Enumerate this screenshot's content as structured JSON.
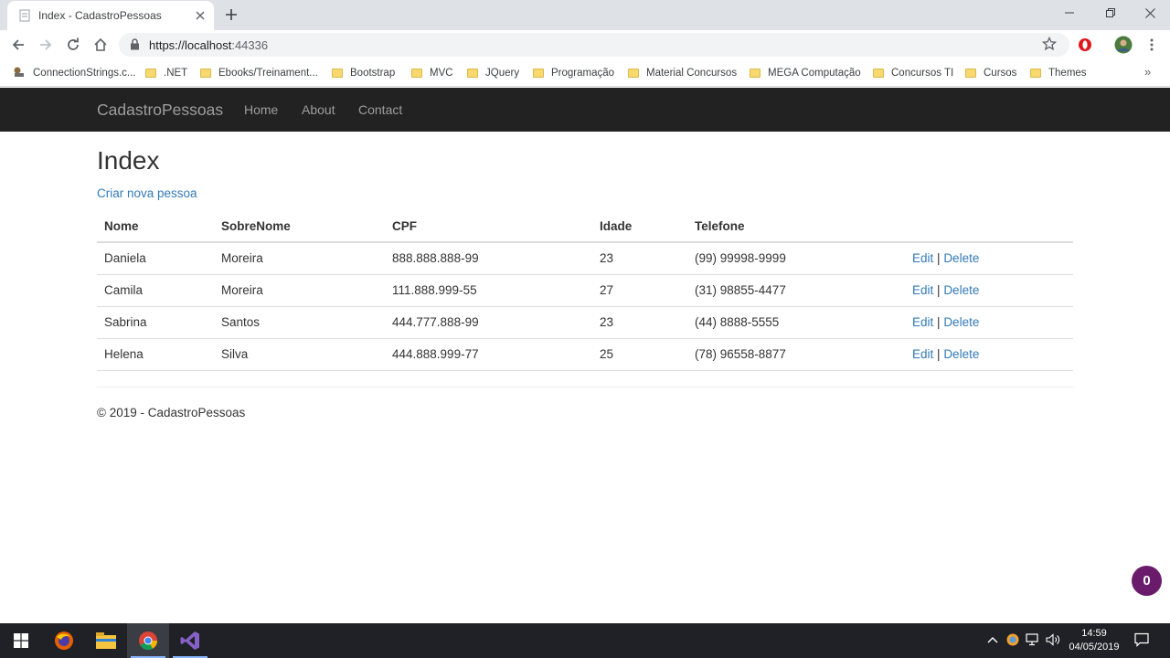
{
  "browser": {
    "tab_title": "Index - CadastroPessoas",
    "url_host": "https://localhost",
    "url_port": ":44336",
    "bookmarks": [
      {
        "label": "ConnectionStrings.c...",
        "icon": "connection-icon"
      },
      {
        "label": ".NET",
        "icon": "folder-icon"
      },
      {
        "label": "Ebooks/Treinament...",
        "icon": "folder-icon"
      },
      {
        "label": "Bootstrap",
        "icon": "folder-icon"
      },
      {
        "label": "MVC",
        "icon": "folder-icon"
      },
      {
        "label": "JQuery",
        "icon": "folder-icon"
      },
      {
        "label": "Programação",
        "icon": "folder-icon"
      },
      {
        "label": "Material Concursos",
        "icon": "folder-icon"
      },
      {
        "label": "MEGA Computação",
        "icon": "folder-icon"
      },
      {
        "label": "Concursos TI",
        "icon": "folder-icon"
      },
      {
        "label": "Cursos",
        "icon": "folder-icon"
      },
      {
        "label": "Themes",
        "icon": "folder-icon"
      }
    ],
    "bookmarks_more": "»"
  },
  "navbar": {
    "brand": "CadastroPessoas",
    "links": [
      "Home",
      "About",
      "Contact"
    ]
  },
  "page": {
    "title": "Index",
    "create_link": "Criar nova pessoa",
    "columns": [
      "Nome",
      "SobreNome",
      "CPF",
      "Idade",
      "Telefone"
    ],
    "rows": [
      {
        "nome": "Daniela",
        "sobrenome": "Moreira",
        "cpf": "888.888.888-99",
        "idade": "23",
        "telefone": "(99) 99998-9999"
      },
      {
        "nome": "Camila",
        "sobrenome": "Moreira",
        "cpf": "111.888.999-55",
        "idade": "27",
        "telefone": "(31) 98855-4477"
      },
      {
        "nome": "Sabrina",
        "sobrenome": "Santos",
        "cpf": "444.777.888-99",
        "idade": "23",
        "telefone": "(44) 8888-5555"
      },
      {
        "nome": "Helena",
        "sobrenome": "Silva",
        "cpf": "444.888.999-77",
        "idade": "25",
        "telefone": "(78) 96558-8877"
      }
    ],
    "edit_label": "Edit",
    "separator": "|",
    "delete_label": "Delete",
    "footer": "© 2019 - CadastroPessoas"
  },
  "badge": {
    "count": "0",
    "color": "#6a1b6b"
  },
  "taskbar": {
    "time": "14:59",
    "date": "04/05/2019"
  },
  "colors": {
    "navbar_bg": "#222222",
    "link": "#337ab7",
    "navbar_text": "#9d9d9d"
  }
}
